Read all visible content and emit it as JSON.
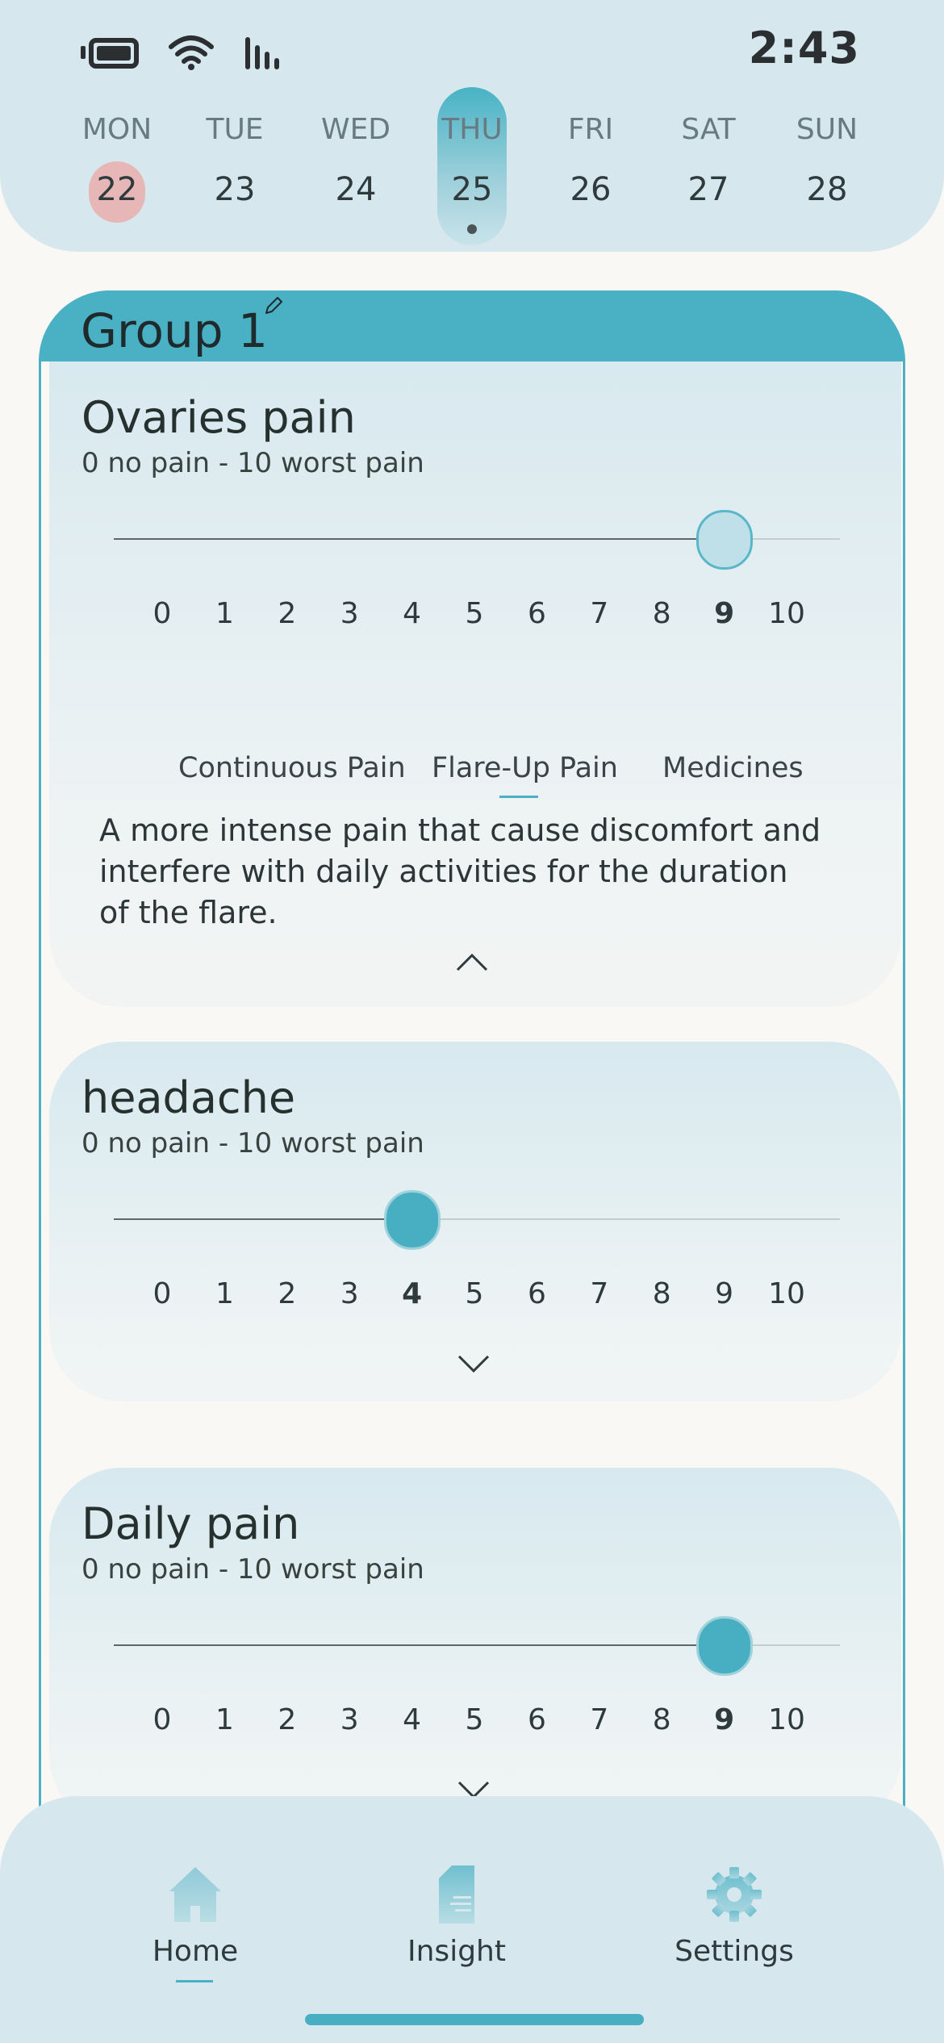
{
  "status_bar": {
    "time": "2:43",
    "icons": [
      "battery-icon",
      "wifi-icon",
      "signal-icon"
    ]
  },
  "week": {
    "days": [
      {
        "name": "MON",
        "num": "22",
        "period": true,
        "selected": false
      },
      {
        "name": "TUE",
        "num": "23",
        "period": false,
        "selected": false
      },
      {
        "name": "WED",
        "num": "24",
        "period": false,
        "selected": false
      },
      {
        "name": "THU",
        "num": "25",
        "period": false,
        "selected": true
      },
      {
        "name": "FRI",
        "num": "26",
        "period": false,
        "selected": false
      },
      {
        "name": "SAT",
        "num": "27",
        "period": false,
        "selected": false
      },
      {
        "name": "SUN",
        "num": "28",
        "period": false,
        "selected": false
      }
    ]
  },
  "group": {
    "title": "Group 1",
    "edit_icon": "pencil-icon"
  },
  "symptoms": [
    {
      "title": "Ovaries pain",
      "subtitle": "0 no pain - 10 worst pain",
      "value": 9,
      "expanded": true,
      "tabs": [
        "Continuous Pain",
        "Flare-Up Pain",
        "Medicines"
      ],
      "active_tab": "Flare-Up Pain",
      "description": "A more intense pain that cause discomfort and interfere with daily activities for the duration of the flare."
    },
    {
      "title": "headache",
      "subtitle": "0 no pain - 10 worst pain",
      "value": 4,
      "expanded": false
    },
    {
      "title": "Daily pain",
      "subtitle": "0 no pain - 10 worst pain",
      "value": 9,
      "expanded": false
    }
  ],
  "scale": [
    "0",
    "1",
    "2",
    "3",
    "4",
    "5",
    "6",
    "7",
    "8",
    "9",
    "10"
  ],
  "nav": {
    "items": [
      {
        "label": "Home",
        "icon": "home-icon",
        "active": true
      },
      {
        "label": "Insight",
        "icon": "insight-icon",
        "active": false
      },
      {
        "label": "Settings",
        "icon": "gear-icon",
        "active": false
      }
    ]
  },
  "colors": {
    "accent": "#4ab0c3",
    "header_bg": "#d6e8ee",
    "period": "#e7b7b8"
  }
}
